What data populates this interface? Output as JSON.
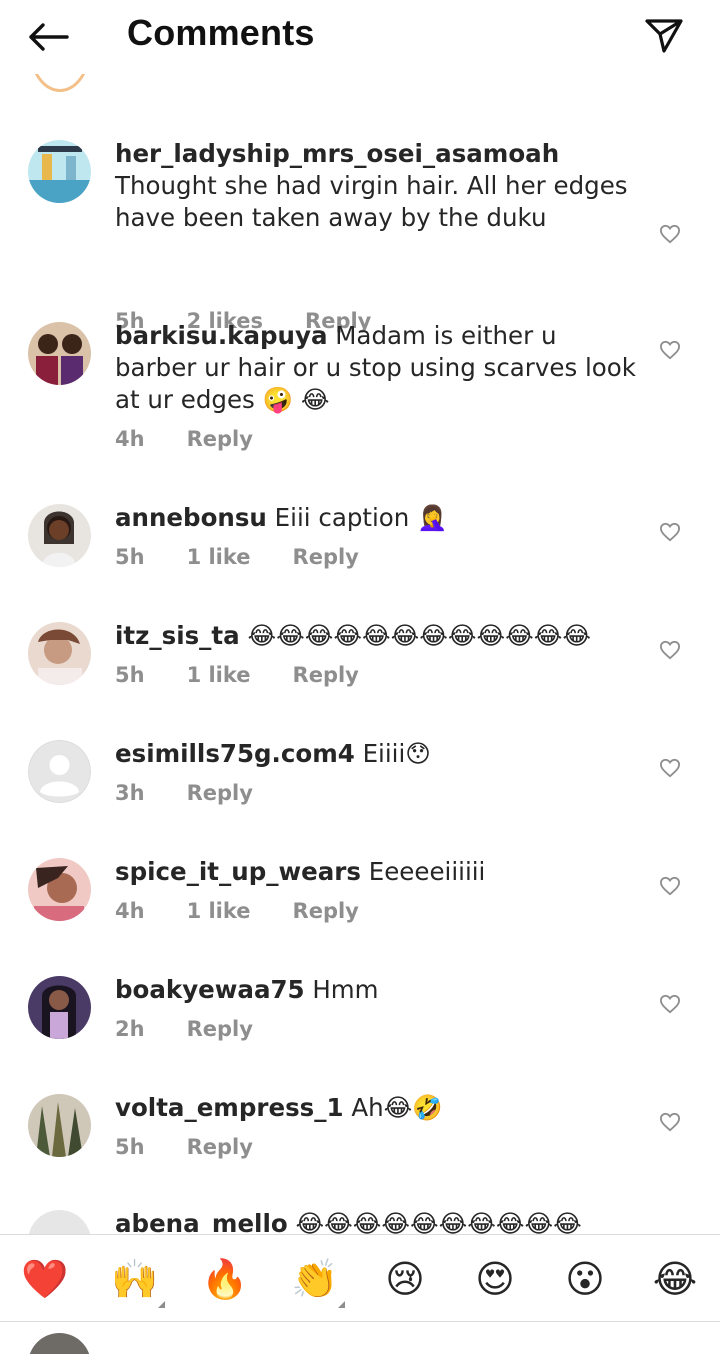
{
  "header": {
    "title": "Comments",
    "back_icon": "arrow-left-icon",
    "share_icon": "paper-plane-icon"
  },
  "comments": [
    {
      "username": "her_ladyship_mrs_osei_asamoah",
      "text": "Thought she had virgin hair. All her edges have been taken away by the duku",
      "time": "5h",
      "likes": "2 likes",
      "reply": "Reply"
    },
    {
      "username": "barkisu.kapuya",
      "text": "Madam is either u barber ur hair or u stop using scarves look at ur edges 🤪 😂",
      "time": "4h",
      "likes": "",
      "reply": "Reply"
    },
    {
      "username": "annebonsu",
      "text": "Eiii caption 🤦‍♀️",
      "time": "5h",
      "likes": "1 like",
      "reply": "Reply"
    },
    {
      "username": "itz_sis_ta",
      "text": "😂😂😂😂😂😂😂😂😂😂😂😂",
      "time": "5h",
      "likes": "1 like",
      "reply": "Reply"
    },
    {
      "username": "esimills75g.com4",
      "text": "Eiiii😯",
      "time": "3h",
      "likes": "",
      "reply": "Reply"
    },
    {
      "username": "spice_it_up_wears",
      "text": "Eeeeeiiiiii",
      "time": "4h",
      "likes": "1 like",
      "reply": "Reply"
    },
    {
      "username": "boakyewaa75",
      "text": "Hmm",
      "time": "2h",
      "likes": "",
      "reply": "Reply"
    },
    {
      "username": "volta_empress_1",
      "text": "Ah😂🤣",
      "time": "5h",
      "likes": "",
      "reply": "Reply"
    }
  ],
  "partial_comment": {
    "username": "abena_mello",
    "text": "😂😂😂😂😂😂😂😂😂😂"
  },
  "emoji_bar": [
    "❤️",
    "🙌",
    "🔥",
    "👏",
    "😢",
    "😍",
    "😮",
    "😂"
  ],
  "colors": {
    "text": "#262626",
    "meta": "#8e8e8e",
    "divider": "#dbdbdb",
    "heart_outline": "#8e8e8e"
  }
}
